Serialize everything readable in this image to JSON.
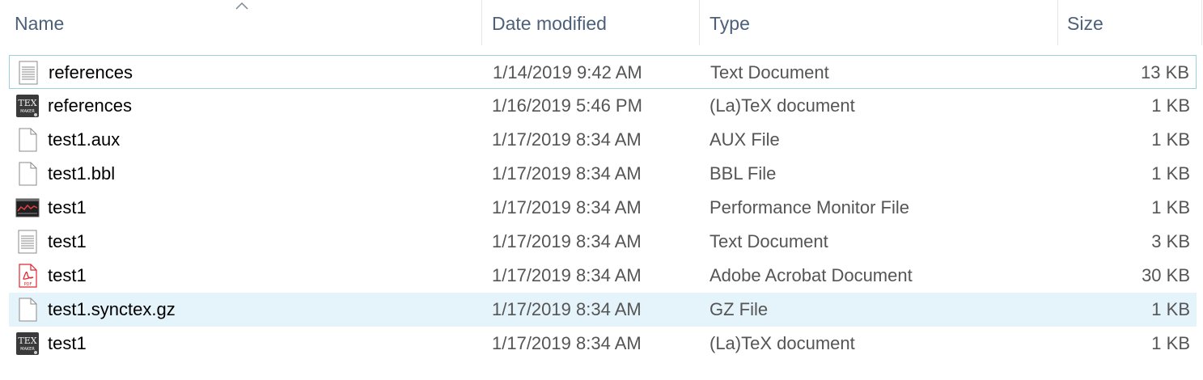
{
  "columns": {
    "name": "Name",
    "date": "Date modified",
    "type": "Type",
    "size": "Size"
  },
  "files": [
    {
      "icon": "text-document-icon",
      "name": "references",
      "date": "1/14/2019 9:42 AM",
      "type": "Text Document",
      "size": "13 KB"
    },
    {
      "icon": "texmaker-icon",
      "name": "references",
      "date": "1/16/2019 5:46 PM",
      "type": "(La)TeX document",
      "size": "1 KB"
    },
    {
      "icon": "blank-file-icon",
      "name": "test1.aux",
      "date": "1/17/2019 8:34 AM",
      "type": "AUX File",
      "size": "1 KB"
    },
    {
      "icon": "blank-file-icon",
      "name": "test1.bbl",
      "date": "1/17/2019 8:34 AM",
      "type": "BBL File",
      "size": "1 KB"
    },
    {
      "icon": "performance-monitor-icon",
      "name": "test1",
      "date": "1/17/2019 8:34 AM",
      "type": "Performance Monitor File",
      "size": "1 KB"
    },
    {
      "icon": "text-document-icon",
      "name": "test1",
      "date": "1/17/2019 8:34 AM",
      "type": "Text Document",
      "size": "3 KB"
    },
    {
      "icon": "pdf-icon",
      "name": "test1",
      "date": "1/17/2019 8:34 AM",
      "type": "Adobe Acrobat Document",
      "size": "30 KB"
    },
    {
      "icon": "blank-file-icon",
      "name": "test1.synctex.gz",
      "date": "1/17/2019 8:34 AM",
      "type": "GZ File",
      "size": "1 KB"
    },
    {
      "icon": "texmaker-icon",
      "name": "test1",
      "date": "1/17/2019 8:34 AM",
      "type": "(La)TeX document",
      "size": "1 KB"
    }
  ],
  "icon_labels": {
    "texmaker_top": "TEX",
    "texmaker_bottom": "MAKER",
    "pdf": "PDF"
  },
  "state": {
    "focused_row": 0,
    "selected_row": 7,
    "sort_column": "Name"
  },
  "colors": {
    "header_text": "#4c607a",
    "selection": "#e5f3fb",
    "focus_border": "#99d1de",
    "pdf_red": "#e0262e"
  }
}
